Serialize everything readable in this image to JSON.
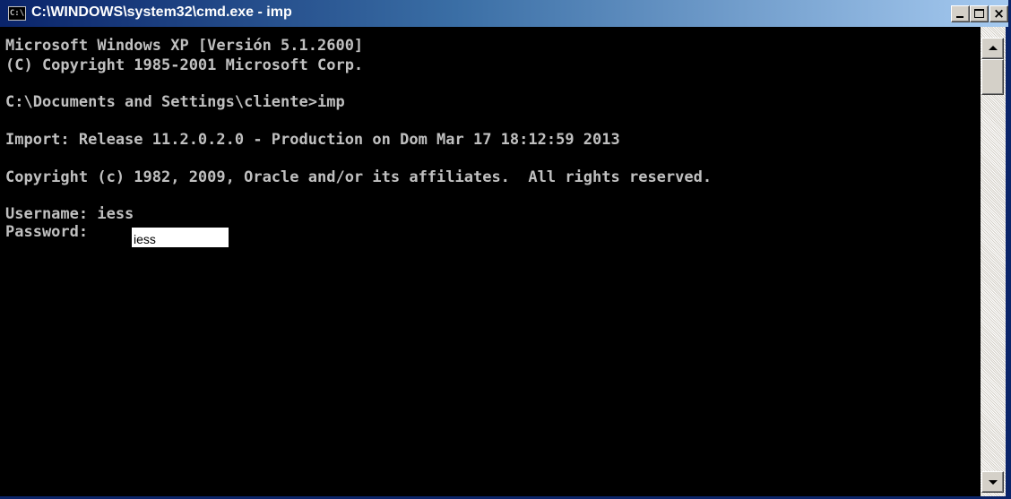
{
  "window": {
    "title": "C:\\WINDOWS\\system32\\cmd.exe - imp",
    "icon_text": "C:\\",
    "icon": "console-icon",
    "controls": {
      "minimize": "minimize-icon",
      "maximize": "maximize-icon",
      "close": "×"
    }
  },
  "console": {
    "lines": [
      "Microsoft Windows XP [Versión 5.1.2600]",
      "(C) Copyright 1985-2001 Microsoft Corp.",
      "C:\\Documents and Settings\\cliente>imp",
      "Import: Release 11.2.0.2.0 - Production on Dom Mar 17 18:12:59 2013",
      "Copyright (c) 1982, 2009, Oracle and/or its affiliates.  All rights reserved.",
      "Username: iess",
      "Password: "
    ],
    "password_value": "iess"
  },
  "colors": {
    "console_background": "#000000",
    "console_text": "#c0c0c0",
    "titlebar_start": "#0a246a",
    "titlebar_end": "#a6caf0"
  }
}
